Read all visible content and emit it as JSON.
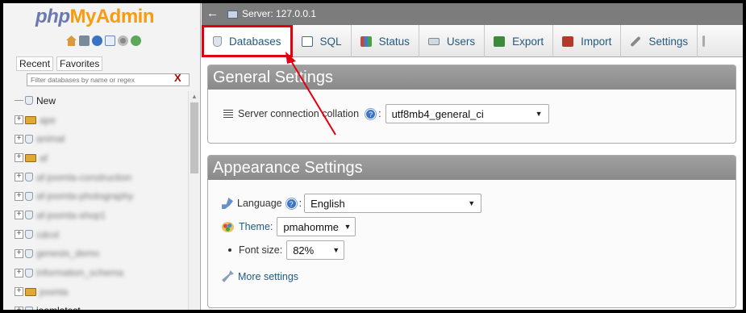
{
  "logo": {
    "php": "php",
    "admin": "MyAdmin"
  },
  "nav_icons": [
    "home-icon",
    "exit-icon",
    "docs-icon",
    "page-icon",
    "gear-icon",
    "reload-icon"
  ],
  "nav_tabs": {
    "recent": "Recent",
    "favorites": "Favorites"
  },
  "filter": {
    "placeholder": "Filter databases by name or regex",
    "clear": "X"
  },
  "databases": [
    {
      "name": "New",
      "kind": "new"
    },
    {
      "name": "ape",
      "kind": "blur"
    },
    {
      "name": "animal",
      "kind": "blur"
    },
    {
      "name": "af",
      "kind": "blur"
    },
    {
      "name": "af-joomla-construction",
      "kind": "blur"
    },
    {
      "name": "af-joomla-photography",
      "kind": "blur"
    },
    {
      "name": "af-joomla-shop1",
      "kind": "blur"
    },
    {
      "name": "cdcol",
      "kind": "blur"
    },
    {
      "name": "genesis_demo",
      "kind": "blur"
    },
    {
      "name": "information_schema",
      "kind": "blur"
    },
    {
      "name": "joomla",
      "kind": "blur"
    },
    {
      "name": "joomlatest",
      "kind": "dark"
    }
  ],
  "topbar": {
    "back": "←",
    "server": "Server: 127.0.0.1"
  },
  "menu": {
    "databases": "Databases",
    "sql": "SQL",
    "status": "Status",
    "users": "Users",
    "export": "Export",
    "import": "Import",
    "settings": "Settings"
  },
  "general": {
    "legend": "General Settings",
    "collation_label": "Server connection collation",
    "collation_value": "utf8mb4_general_ci",
    "help": "?"
  },
  "appearance": {
    "legend": "Appearance Settings",
    "language_label": "Language",
    "language_value": "English",
    "theme_label": "Theme:",
    "theme_value": "pmahomme",
    "font_label": "Font size:",
    "font_value": "82%",
    "more": "More settings",
    "help": "?"
  },
  "colors": {
    "annotation": "#e1000f",
    "link": "#235a81",
    "logo_php": "#6c78af",
    "logo_admin": "#f89c0e"
  }
}
